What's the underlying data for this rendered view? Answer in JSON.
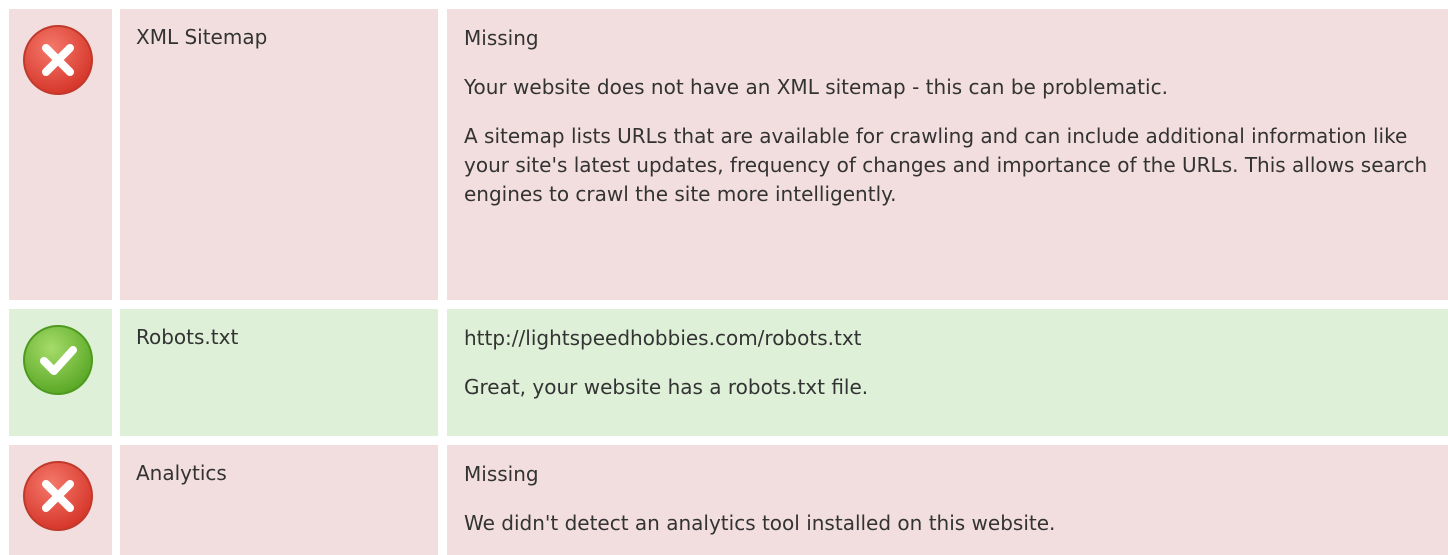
{
  "colors": {
    "error_row_bg": "#f2dede",
    "success_row_bg": "#dff0d8",
    "error_icon": "#e74c3c",
    "success_icon": "#6bbf31",
    "text": "#333333"
  },
  "rows": [
    {
      "status": "error",
      "icon": "error-x-icon",
      "label": "XML Sitemap",
      "value": "Missing",
      "message": "Your website does not have an XML sitemap - this can be problematic.",
      "description": "A sitemap lists URLs that are available for crawling and can include additional information like your site's latest updates, frequency of changes and importance of the URLs. This allows search engines to crawl the site more intelligently."
    },
    {
      "status": "success",
      "icon": "success-check-icon",
      "label": "Robots.txt",
      "value": "http://lightspeedhobbies.com/robots.txt",
      "message": "Great, your website has a robots.txt file."
    },
    {
      "status": "error",
      "icon": "error-x-icon",
      "label": "Analytics",
      "value": "Missing",
      "message": "We didn't detect an analytics tool installed on this website."
    }
  ]
}
